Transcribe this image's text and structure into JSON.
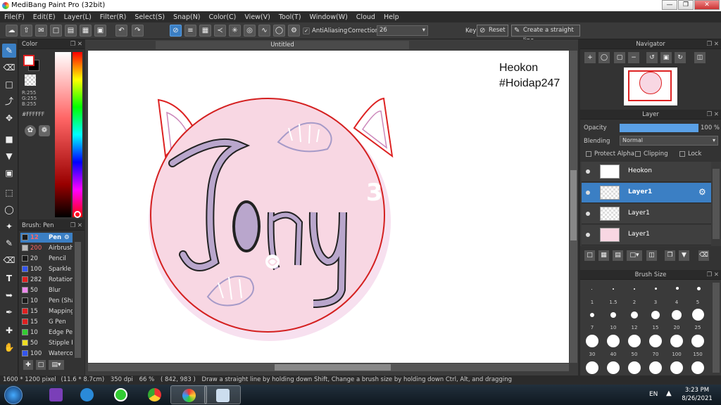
{
  "window": {
    "title": "MediBang Paint Pro (32bit)"
  },
  "menu": [
    "File(F)",
    "Edit(E)",
    "Layer(L)",
    "Filter(R)",
    "Select(S)",
    "Snap(N)",
    "Color(C)",
    "View(V)",
    "Tool(T)",
    "Window(W)",
    "Cloud",
    "Help"
  ],
  "toolbar": {
    "antialiasing_label": "AntiAliasing",
    "correction_label": "Correction",
    "correction_value": "26",
    "key_label": "Key",
    "reset_label": "Reset",
    "straight_line_label": "Create a straight line"
  },
  "color_panel": {
    "title": "Color",
    "r": "R:255",
    "g": "G:255",
    "b": "B:255",
    "hex": "#FFFFFF",
    "primary": "#ffffff",
    "accent": "#e02020"
  },
  "brush_panel": {
    "title": "Brush: Pen",
    "items": [
      {
        "size": "12",
        "name": "Pen",
        "color": "#1a1a1a"
      },
      {
        "size": "200",
        "name": "Airbrush",
        "color": "#bbbbbb"
      },
      {
        "size": "20",
        "name": "Pencil",
        "color": "#1a1a1a"
      },
      {
        "size": "100",
        "name": "Sparkle B",
        "color": "#3355ee"
      },
      {
        "size": "282",
        "name": "Rotation",
        "color": "#e02020"
      },
      {
        "size": "50",
        "name": "Blur",
        "color": "#ee88ee"
      },
      {
        "size": "10",
        "name": "Pen (Sha",
        "color": "#1a1a1a"
      },
      {
        "size": "15",
        "name": "Mapping",
        "color": "#e02020"
      },
      {
        "size": "15",
        "name": "G Pen",
        "color": "#e02020"
      },
      {
        "size": "10",
        "name": "Edge Pen",
        "color": "#33cc33"
      },
      {
        "size": "50",
        "name": "Stipple P",
        "color": "#eedd22"
      },
      {
        "size": "100",
        "name": "Waterco",
        "color": "#3355ee"
      }
    ]
  },
  "document": {
    "tab": "Untitled",
    "text_line1": "Heokon",
    "text_line2": "#Hoidap247",
    "lettering": "Jony",
    "number_mark": "3"
  },
  "navigator": {
    "title": "Navigator"
  },
  "layer_panel": {
    "title": "Layer",
    "opacity_label": "Opacity",
    "opacity_value": "100 %",
    "opacity_fraction": 1.0,
    "blending_label": "Blending",
    "blending_value": "Normal",
    "protect_alpha": "Protect Alpha",
    "clipping": "Clipping",
    "lock": "Lock",
    "layers": [
      {
        "name": "Heokon",
        "selected": false
      },
      {
        "name": "Layer1",
        "selected": true
      },
      {
        "name": "Layer1",
        "selected": false
      },
      {
        "name": "Layer1",
        "selected": false
      }
    ]
  },
  "brush_size_panel": {
    "title": "Brush Size",
    "row1": [
      "1",
      "1.5",
      "2",
      "3",
      "4",
      "5"
    ],
    "row2": [
      "7",
      "10",
      "12",
      "15",
      "20",
      "25"
    ],
    "row3": [
      "30",
      "40",
      "50",
      "70",
      "100",
      "150"
    ]
  },
  "status": {
    "size": "1600 * 1200 pixel",
    "cm": "(11.6 * 8.7cm)",
    "dpi": "350 dpi",
    "zoom": "66 %",
    "coords": "( 842, 983 )",
    "hint": "Draw a straight line by holding down Shift, Change a brush size by holding down Ctrl, Alt, and dragging"
  },
  "taskbar": {
    "lang": "EN",
    "time": "3:23 PM",
    "date": "8/26/2021"
  }
}
